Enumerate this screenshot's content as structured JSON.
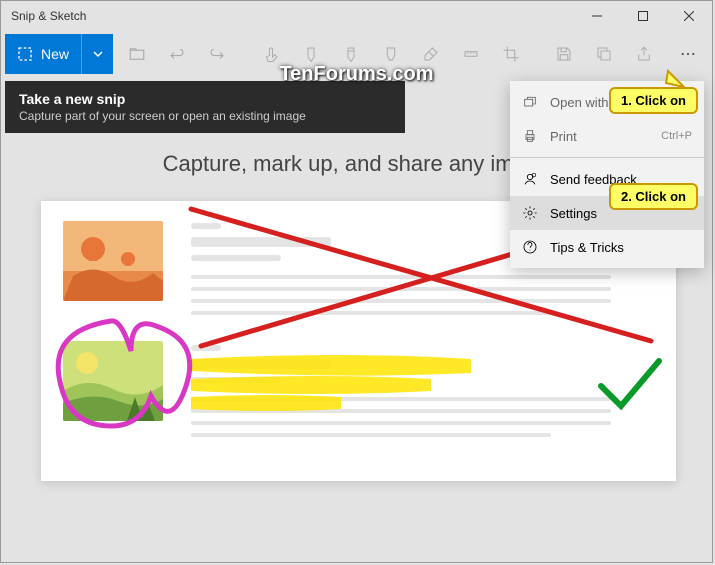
{
  "window": {
    "title": "Snip & Sketch"
  },
  "toolbar": {
    "new_label": "New"
  },
  "tooltip": {
    "title": "Take a new snip",
    "subtitle": "Capture part of your screen or open an existing image"
  },
  "watermark": "TenForums.com",
  "menu": {
    "items": [
      {
        "label": "Open with",
        "shortcut": "",
        "enabled": false
      },
      {
        "label": "Print",
        "shortcut": "Ctrl+P",
        "enabled": false
      },
      {
        "label": "Send feedback",
        "shortcut": "",
        "enabled": true
      },
      {
        "label": "Settings",
        "shortcut": "",
        "enabled": true
      },
      {
        "label": "Tips & Tricks",
        "shortcut": "",
        "enabled": true
      }
    ]
  },
  "content": {
    "caption": "Capture, mark up, and share any image"
  },
  "callouts": {
    "c1": "1. Click on",
    "c2": "2. Click on"
  }
}
